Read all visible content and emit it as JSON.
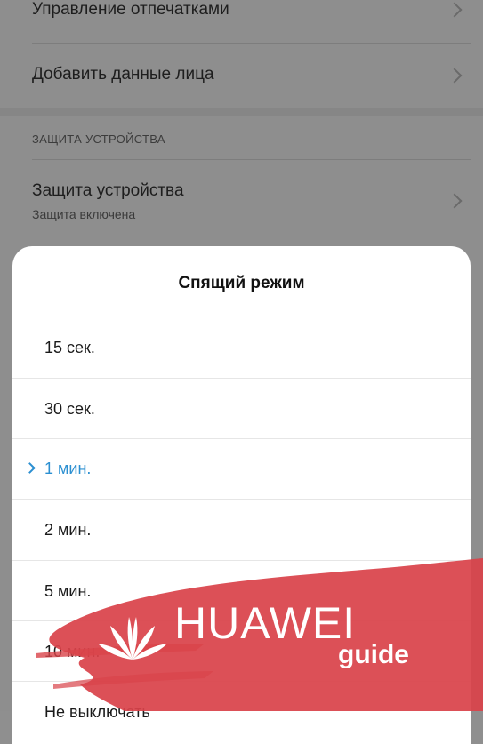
{
  "settings": {
    "items": [
      {
        "title": "Управление отпечатками"
      },
      {
        "title": "Добавить данные лица"
      }
    ],
    "section_header": "ЗАЩИТА УСТРОЙСТВА",
    "device_protection": {
      "title": "Защита устройства",
      "subtitle": "Защита включена"
    }
  },
  "dialog": {
    "title": "Спящий режим",
    "options": [
      {
        "label": "15 сек."
      },
      {
        "label": "30 сек."
      },
      {
        "label": "1 мин.",
        "selected": true
      },
      {
        "label": "2 мин."
      },
      {
        "label": "5 мин."
      },
      {
        "label": "10 мин."
      },
      {
        "label": "Не выключать"
      }
    ]
  },
  "watermark": {
    "brand": "HUAWEI",
    "suffix": "guide"
  },
  "colors": {
    "accent": "#2b8fd1",
    "watermark_red": "#d9434a"
  }
}
